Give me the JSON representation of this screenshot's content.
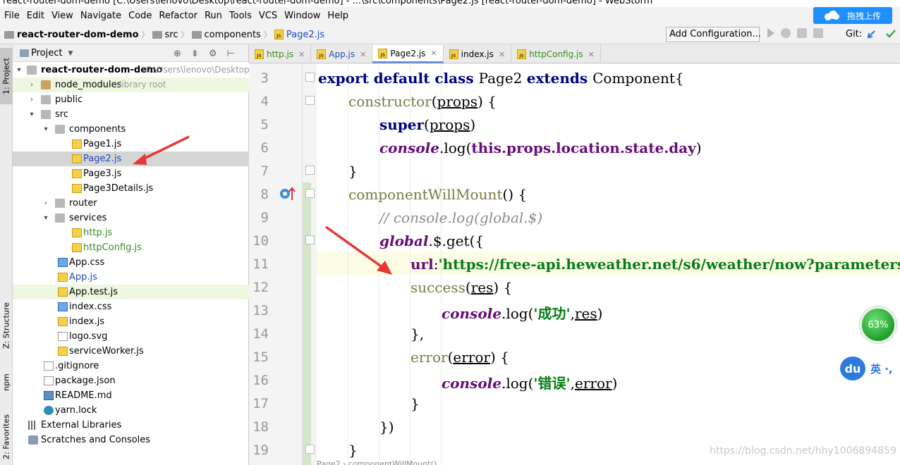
{
  "window": {
    "title": "react-router-dom-demo [C:\\Users\\lenovo\\Desktop\\react-router-dom-demo] - ...\\src\\components\\Page2.js [react-router-dom-demo] - WebStorm"
  },
  "menu": [
    "File",
    "Edit",
    "View",
    "Navigate",
    "Code",
    "Refactor",
    "Run",
    "Tools",
    "VCS",
    "Window",
    "Help"
  ],
  "upload_button": {
    "label": "拖拽上传",
    "icon": "cloud-icon"
  },
  "breadcrumb": [
    "react-router-dom-demo",
    "src",
    "components",
    "Page2.js"
  ],
  "toolbar": {
    "add_configuration": "Add Configuration...",
    "git_label": "Git:"
  },
  "left_strip": {
    "project": "1: Project",
    "structure": "Z: Structure",
    "npm": "npm",
    "favorites": "2: Favorites"
  },
  "project_panel": {
    "title": "Project",
    "root_name": "react-router-dom-demo",
    "root_path": "C:\\Users\\lenovo\\Desktop",
    "items": [
      {
        "label": "node_modules",
        "suffix": "library root"
      },
      {
        "label": "public"
      },
      {
        "label": "src"
      },
      {
        "label": "components"
      },
      {
        "label": "Page1.js"
      },
      {
        "label": "Page2.js"
      },
      {
        "label": "Page3.js"
      },
      {
        "label": "Page3Details.js"
      },
      {
        "label": "router"
      },
      {
        "label": "services"
      },
      {
        "label": "http.js"
      },
      {
        "label": "httpConfig.js"
      },
      {
        "label": "App.css"
      },
      {
        "label": "App.js"
      },
      {
        "label": "App.test.js"
      },
      {
        "label": "index.css"
      },
      {
        "label": "index.js"
      },
      {
        "label": "logo.svg"
      },
      {
        "label": "serviceWorker.js"
      },
      {
        "label": ".gitignore"
      },
      {
        "label": "package.json"
      },
      {
        "label": "README.md"
      },
      {
        "label": "yarn.lock"
      },
      {
        "label": "External Libraries"
      },
      {
        "label": "Scratches and Consoles"
      }
    ]
  },
  "tabs": [
    "http.js",
    "App.js",
    "Page2.js",
    "index.js",
    "httpConfig.js"
  ],
  "active_tab": "Page2.js",
  "line_numbers": [
    "3",
    "4",
    "5",
    "6",
    "7",
    "8",
    "9",
    "10",
    "11",
    "12",
    "13",
    "14",
    "15",
    "16",
    "17",
    "18",
    "19"
  ],
  "code": {
    "l3_kw": "export default class ",
    "l3_rest": "Page2 ",
    "l3_kw2": "extends ",
    "l3_end": "Component{",
    "l4_fn": "constructor",
    "l4_p": "props",
    "l4_end": ") {",
    "l5_kw": "super",
    "l5_p": "props",
    "l6_console": "console",
    "l6_log": ".log(",
    "l6_chain": "this.props.location.state.day",
    "l7": "}",
    "l8_fn": "componentWillMount",
    "l8_end": "() {",
    "l9_cm": "// console.log(global.$)",
    "l10_global": "global",
    "l10_rest": ".$.get({",
    "l11_key": "url",
    "l11_colon": ":",
    "l11_str": "'https://free-api.heweather.net/s6/weather/now?parameters",
    "l11_end": "',",
    "l12_fn": "success",
    "l12_p": "res",
    "l12_end": ") {",
    "l13_console": "console",
    "l13_log": ".log(",
    "l13_str": "'成功'",
    "l13_p": "res",
    "l14": "},",
    "l15_fn": "error",
    "l15_p": "error",
    "l15_end": ") {",
    "l16_console": "console",
    "l16_log": ".log(",
    "l16_str": "'错误'",
    "l16_p": "error",
    "l17": "}",
    "l18": "})",
    "l19": "}"
  },
  "overlays": {
    "gauge_value": "63%",
    "du_label": "du",
    "ime_label": "英 ·,",
    "watermark": "https://blog.csdn.net/hhy1006894859",
    "bottom_hint": "Page2  ›  componentWillMount()"
  },
  "colors": {
    "accent": "#1f8fff",
    "keyword": "#000080",
    "string": "#067d17",
    "gauge": "#1f9e2b",
    "arrow": "#e53935"
  }
}
